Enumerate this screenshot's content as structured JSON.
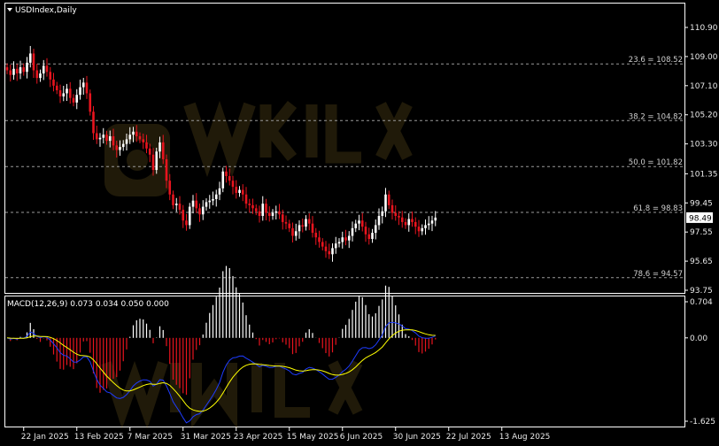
{
  "window": {
    "symbol_title": "USDIndex,Daily",
    "macd_title": "MACD(12,26,9) 0.073 0.034 0.050 0.000",
    "current_price_label": "98.49"
  },
  "colors": {
    "background": "#000000",
    "frame": "#ffffff",
    "bull_candle": "#ffffff",
    "bear_candle": "#e8141e",
    "fib_line": "#9a9a9a",
    "macd_positive_hist": "#ffffff",
    "macd_negative_hist": "#e8141e",
    "macd_line": "#1e3cff",
    "signal_line": "#ffff00",
    "watermark": "#c8a23a"
  },
  "icons": {
    "title_marker": "triangle-down-icon",
    "watermark": "logo-watermark"
  },
  "chart_data": [
    {
      "type": "candlestick",
      "title": "USDIndex,Daily",
      "ylim": [
        93.75,
        111.0
      ],
      "y_ticks": [
        "110.90",
        "109.00",
        "107.10",
        "105.20",
        "103.30",
        "101.35",
        "99.45",
        "97.55",
        "95.65",
        "93.75"
      ],
      "y_tick_values": [
        110.9,
        109.0,
        107.1,
        105.2,
        103.3,
        101.35,
        99.45,
        97.55,
        95.65,
        93.75
      ],
      "x_tick_labels": [
        "22 Jan 2025",
        "13 Feb 2025",
        "7 Mar 2025",
        "31 Mar 2025",
        "23 Apr 2025",
        "15 May 2025",
        "6 Jun 2025",
        "30 Jun 2025",
        "22 Jul 2025",
        "13 Aug 2025"
      ],
      "x_tick_bar_index": [
        5,
        21,
        37,
        53,
        69,
        85,
        101,
        117,
        133,
        149
      ],
      "fib_levels": [
        {
          "label": "23.6 = 108.52",
          "value": 108.52
        },
        {
          "label": "38.2 = 104.82",
          "value": 104.82
        },
        {
          "label": "50.0 = 101.82",
          "value": 101.82
        },
        {
          "label": "61.8 = 98.83",
          "value": 98.83
        },
        {
          "label": "78.6 = 94.57",
          "value": 94.57
        }
      ],
      "last_price": 98.49,
      "closes": [
        108.1,
        107.8,
        108.2,
        107.9,
        108.3,
        108.0,
        108.6,
        109.2,
        108.1,
        107.6,
        107.9,
        108.4,
        108.0,
        107.5,
        107.1,
        106.8,
        106.4,
        106.6,
        106.9,
        106.3,
        106.0,
        106.5,
        107.0,
        107.3,
        106.6,
        105.4,
        104.0,
        103.6,
        103.7,
        103.9,
        103.5,
        103.8,
        103.2,
        102.9,
        103.1,
        103.3,
        103.6,
        103.9,
        104.1,
        103.8,
        103.6,
        103.4,
        103.0,
        102.6,
        101.6,
        102.8,
        103.4,
        102.3,
        100.9,
        100.0,
        99.3,
        99.4,
        99.0,
        98.3,
        98.0,
        99.2,
        99.6,
        99.1,
        98.7,
        99.2,
        99.5,
        99.6,
        99.7,
        100.0,
        100.4,
        101.5,
        101.2,
        100.9,
        100.5,
        100.1,
        100.3,
        100.0,
        99.4,
        99.3,
        99.1,
        98.9,
        98.6,
        99.4,
        98.8,
        98.6,
        98.8,
        98.9,
        98.7,
        98.2,
        98.1,
        97.8,
        97.3,
        97.6,
        98.0,
        97.9,
        98.4,
        98.1,
        97.5,
        97.2,
        96.9,
        96.6,
        96.3,
        96.1,
        96.5,
        96.8,
        96.9,
        97.2,
        97.0,
        97.3,
        97.8,
        98.1,
        98.3,
        97.9,
        97.4,
        97.1,
        97.5,
        98.0,
        98.6,
        98.9,
        100.0,
        99.3,
        98.8,
        98.6,
        98.5,
        98.2,
        98.0,
        98.4,
        98.2,
        97.9,
        97.6,
        97.8,
        98.0,
        98.1,
        98.3,
        98.49
      ]
    },
    {
      "type": "macd",
      "title": "MACD(12,26,9) 0.073 0.034 0.050 0.000",
      "params": "12,26,9",
      "values_shown": [
        0.073,
        0.034,
        0.05,
        0.0
      ],
      "ylim": [
        -1.7,
        0.75
      ],
      "y_ticks": [
        "0.704",
        "0.00",
        "-1.625"
      ],
      "y_tick_values": [
        0.704,
        0.0,
        -1.625
      ]
    }
  ]
}
